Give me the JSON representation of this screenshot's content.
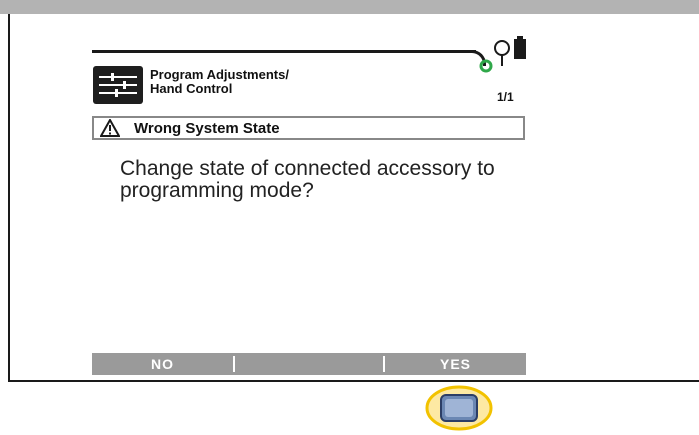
{
  "header": {
    "menu_title_line1": "Program Adjustments/",
    "menu_title_line2": "Hand Control",
    "page_indicator": "1/1",
    "menu_icon": "sliders-icon",
    "status_icons": [
      "hearing-aid-status-icon",
      "battery-icon"
    ]
  },
  "warning": {
    "icon": "warning-triangle-icon",
    "title": "Wrong System State"
  },
  "message": {
    "text": "Change state of connected accessory to programming mode?"
  },
  "softkeys": {
    "left_label": "NO",
    "middle_label": "",
    "right_label": "YES"
  },
  "hardware": {
    "button_icon": "right-softkey-button-icon",
    "highlight_color": "#f2c200"
  },
  "colors": {
    "status_ring": "#2fa84a",
    "softkey_bar": "#9a9a9a"
  }
}
